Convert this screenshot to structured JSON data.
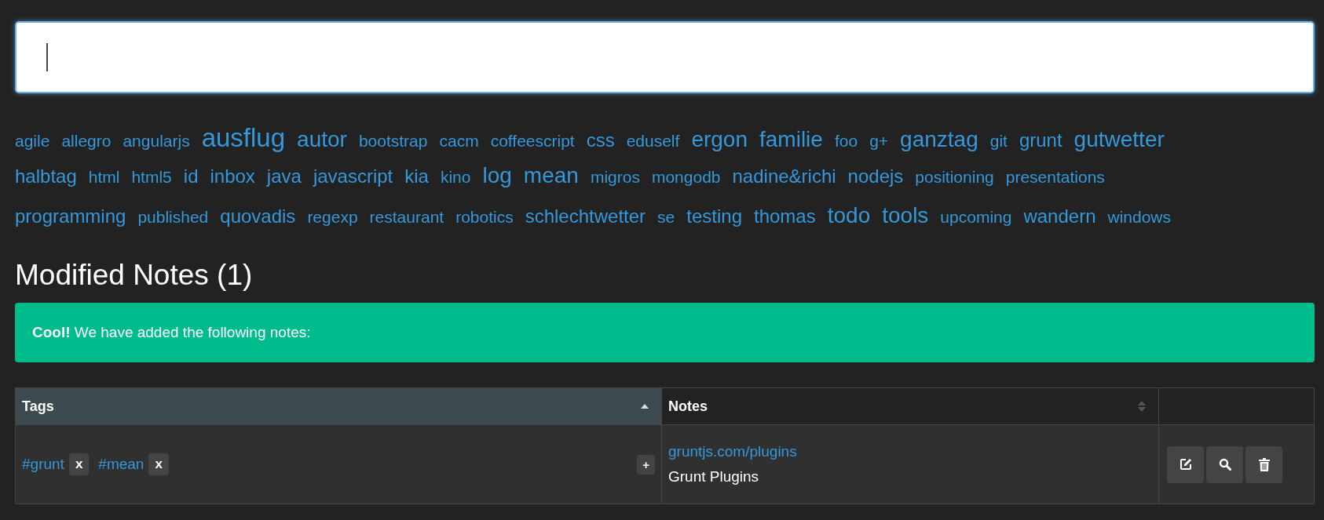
{
  "search": {
    "focused": true
  },
  "tag_rows": [
    {
      "tags": [
        {
          "label": "agile",
          "kind": "small"
        },
        {
          "label": "allegro",
          "kind": "small"
        },
        {
          "label": "angularjs",
          "kind": "small"
        },
        {
          "label": "ausflug",
          "kind": "huge"
        },
        {
          "label": "autor",
          "kind": "large"
        },
        {
          "label": "bootstrap",
          "kind": "small"
        },
        {
          "label": "cacm",
          "kind": "small"
        },
        {
          "label": "coffeescript",
          "kind": "small"
        },
        {
          "label": "css",
          "kind": "medium"
        },
        {
          "label": "eduself",
          "kind": "small"
        },
        {
          "label": "ergon",
          "kind": "large"
        },
        {
          "label": "familie",
          "kind": "large"
        },
        {
          "label": "foo",
          "kind": "small"
        },
        {
          "label": "g+",
          "kind": "small"
        },
        {
          "label": "ganztag",
          "kind": "large"
        },
        {
          "label": "git",
          "kind": "small"
        },
        {
          "label": "grunt",
          "kind": "medium"
        },
        {
          "label": "gutwetter",
          "kind": "large"
        }
      ]
    },
    {
      "tags": [
        {
          "label": "halbtag",
          "kind": "medium"
        },
        {
          "label": "html",
          "kind": "small"
        },
        {
          "label": "html5",
          "kind": "small"
        },
        {
          "label": "id",
          "kind": "medium"
        },
        {
          "label": "inbox",
          "kind": "medium"
        },
        {
          "label": "java",
          "kind": "medium"
        },
        {
          "label": "javascript",
          "kind": "medium"
        },
        {
          "label": "kia",
          "kind": "medium"
        },
        {
          "label": "kino",
          "kind": "small"
        },
        {
          "label": "log",
          "kind": "large"
        },
        {
          "label": "mean",
          "kind": "large"
        },
        {
          "label": "migros",
          "kind": "small"
        },
        {
          "label": "mongodb",
          "kind": "small"
        },
        {
          "label": "nadine&richi",
          "kind": "medium"
        },
        {
          "label": "nodejs",
          "kind": "medium"
        },
        {
          "label": "positioning",
          "kind": "small"
        },
        {
          "label": "presentations",
          "kind": "small"
        }
      ]
    },
    {
      "tags": [
        {
          "label": "programming",
          "kind": "medium"
        },
        {
          "label": "published",
          "kind": "small"
        },
        {
          "label": "quovadis",
          "kind": "medium"
        },
        {
          "label": "regexp",
          "kind": "small"
        },
        {
          "label": "restaurant",
          "kind": "small"
        },
        {
          "label": "robotics",
          "kind": "small"
        },
        {
          "label": "schlechtwetter",
          "kind": "medium"
        },
        {
          "label": "se",
          "kind": "small"
        },
        {
          "label": "testing",
          "kind": "medium"
        },
        {
          "label": "thomas",
          "kind": "medium"
        },
        {
          "label": "todo",
          "kind": "large"
        },
        {
          "label": "tools",
          "kind": "large"
        },
        {
          "label": "upcoming",
          "kind": "small"
        },
        {
          "label": "wandern",
          "kind": "medium"
        },
        {
          "label": "windows",
          "kind": "small"
        }
      ]
    }
  ],
  "heading": "Modified Notes (1)",
  "alert": {
    "text": "**Cool!** We have added the following notes:"
  },
  "table": {
    "columns": [
      {
        "label": "Tags",
        "selected": true
      },
      {
        "label": "Notes",
        "selected": false
      }
    ],
    "rows": [
      {
        "tags": [
          {
            "label": "#grunt",
            "remove": "x"
          },
          {
            "label": "#mean",
            "remove": "x"
          }
        ],
        "add": "+",
        "link": "gruntjs.com/plugins",
        "title": "Grunt Plugins",
        "actions": [
          {
            "kind": "edit"
          },
          {
            "kind": "view"
          },
          {
            "kind": "delete"
          }
        ]
      }
    ]
  }
}
